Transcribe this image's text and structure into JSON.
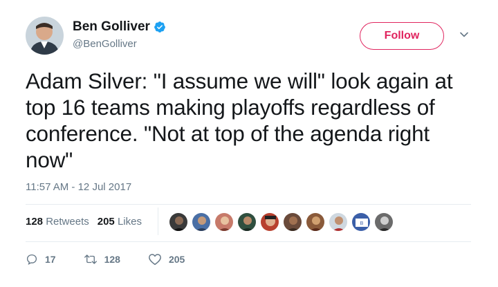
{
  "user": {
    "name": "Ben Golliver",
    "handle": "@BenGolliver",
    "verified": true
  },
  "follow_label": "Follow",
  "tweet": {
    "line1": "Adam Silver: \"I assume we will\" look again at",
    "line2": "top 16 teams making playoffs regardless of",
    "line3": "conference. \"Not at top of the agenda right",
    "line4": "now\""
  },
  "timestamp": "11:57 AM - 12 Jul 2017",
  "stats": {
    "retweets_count": "128",
    "retweets_label": "Retweets",
    "likes_count": "205",
    "likes_label": "Likes"
  },
  "likers_count_shown": 9,
  "actions": {
    "replies": "17",
    "retweets": "128",
    "likes": "205"
  },
  "colors": {
    "accent": "#e0245e",
    "verified": "#1da1f2",
    "muted": "#657786",
    "text": "#14171a"
  }
}
